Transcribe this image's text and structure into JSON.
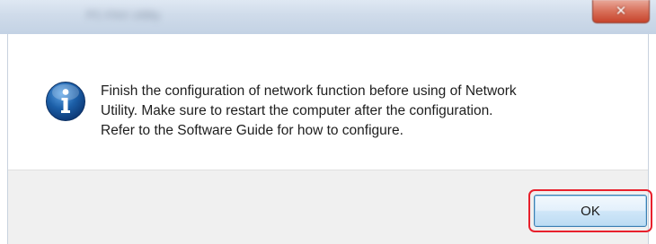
{
  "window": {
    "title": "PC-FAX Utility",
    "close_label": "✕"
  },
  "dialog": {
    "icon": "info-icon",
    "message_lines": [
      "Finish the configuration of network function before using of Network",
      "Utility. Make sure to restart the computer after the configuration.",
      "Refer to the Software Guide for how to configure."
    ]
  },
  "buttons": {
    "ok_label": "OK"
  },
  "colors": {
    "highlight": "#e8202c",
    "icon_blue": "#1c5fa8",
    "footer_bg": "#f0f0f0"
  }
}
